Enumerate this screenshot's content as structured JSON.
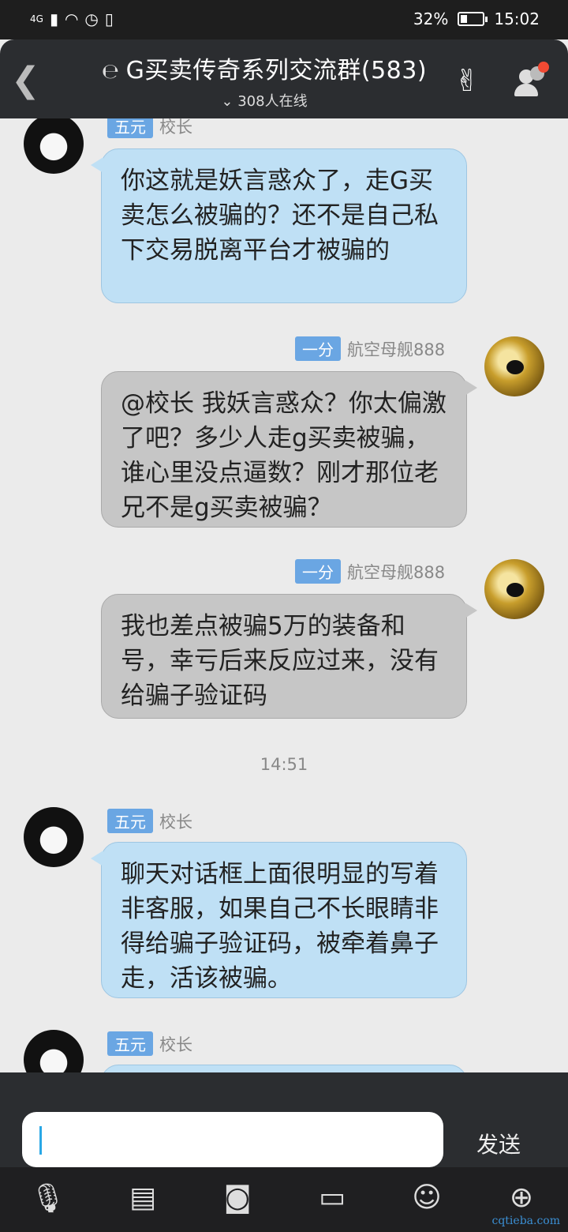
{
  "status_bar": {
    "network": "4G",
    "battery": "32%",
    "battery_level": 0.32,
    "time": "15:02"
  },
  "header": {
    "title": "G买卖传奇系列交流群(583)",
    "online": "308人在线"
  },
  "messages": [
    {
      "side": "left",
      "badge": "五元",
      "name": "校长",
      "text": "你这就是妖言惑众了，走G买卖怎么被骗的？还不是自己私下交易脱离平台才被骗的"
    },
    {
      "side": "right",
      "badge": "一分",
      "name": "航空母舰888",
      "text": "@校长 我妖言惑众？你太偏激了吧？多少人走g买卖被骗，谁心里没点逼数？刚才那位老兄不是g买卖被骗？"
    },
    {
      "side": "right",
      "badge": "一分",
      "name": "航空母舰888",
      "text": "我也差点被骗5万的装备和号，幸亏后来反应过来，没有给骗子验证码"
    },
    {
      "timestamp": "14:51"
    },
    {
      "side": "left",
      "badge": "五元",
      "name": "校长",
      "text": "聊天对话框上面很明显的写着非客服，如果自己不长眼睛非得给骗子验证码，被牵着鼻子走，活该被骗。"
    },
    {
      "side": "left",
      "badge": "五元",
      "name": "校长",
      "text": ""
    }
  ],
  "input": {
    "placeholder": "",
    "send_label": "发送"
  },
  "toolbar": [
    "microphone-icon",
    "image-icon",
    "camera-icon",
    "card-icon",
    "emoji-icon",
    "plus-icon"
  ],
  "watermark": "cqtieba.com"
}
